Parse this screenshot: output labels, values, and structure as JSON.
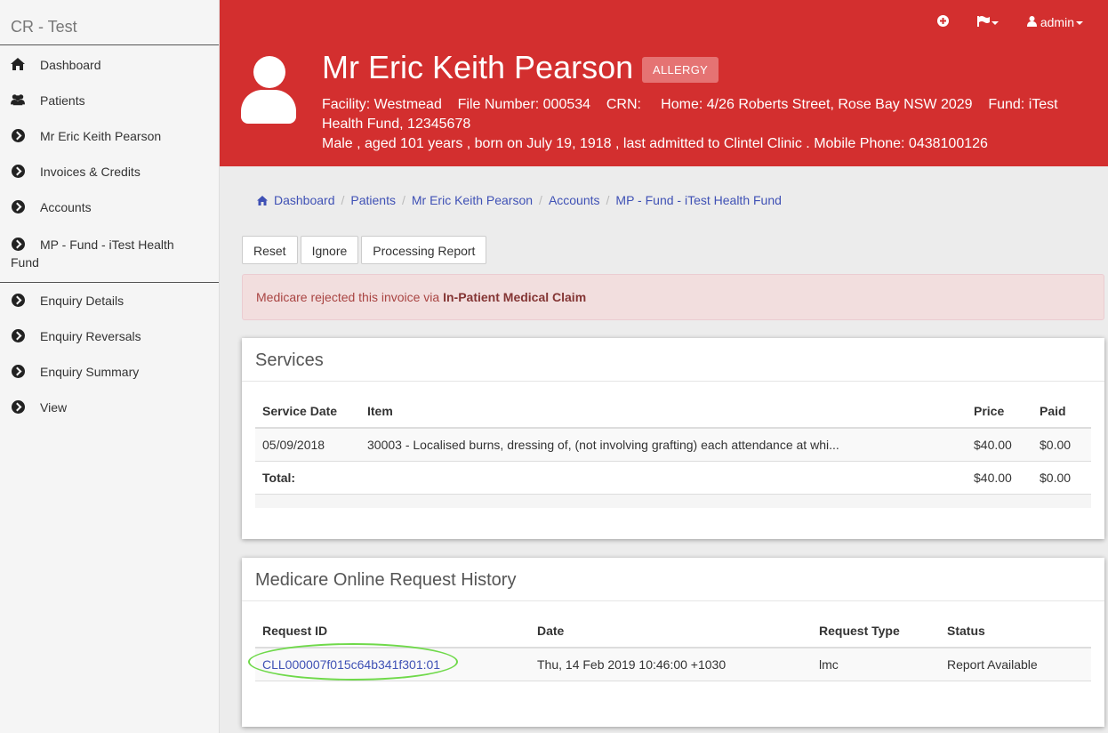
{
  "app": {
    "title": "CR - Test"
  },
  "sidebar": {
    "items": [
      {
        "label": "Dashboard",
        "icon": "home-icon"
      },
      {
        "label": "Patients",
        "icon": "users-icon"
      },
      {
        "label": "Mr Eric Keith Pearson",
        "icon": "chevron-circle-right-icon"
      },
      {
        "label": "Invoices & Credits",
        "icon": "chevron-circle-right-icon"
      },
      {
        "label": "Accounts",
        "icon": "chevron-circle-right-icon"
      },
      {
        "label": "MP - Fund - iTest Health Fund",
        "icon": "chevron-circle-right-icon"
      },
      {
        "label": "Enquiry Details",
        "icon": "chevron-circle-right-icon"
      },
      {
        "label": "Enquiry Reversals",
        "icon": "chevron-circle-right-icon"
      },
      {
        "label": "Enquiry Summary",
        "icon": "chevron-circle-right-icon"
      },
      {
        "label": "View",
        "icon": "chevron-circle-right-icon"
      }
    ]
  },
  "topnav": {
    "user": "admin"
  },
  "patient": {
    "name": "Mr Eric Keith Pearson",
    "badge": "ALLERGY",
    "line1": "Facility: Westmead    File Number: 000534    CRN:     Home: 4/26 Roberts Street, Rose Bay NSW 2029    Fund: iTest Health Fund, 12345678",
    "line2": "Male , aged 101 years , born on July 19, 1918 , last admitted to Clintel Clinic . Mobile Phone: 0438100126"
  },
  "breadcrumb": [
    "Dashboard",
    "Patients",
    "Mr Eric Keith Pearson",
    "Accounts",
    "MP - Fund - iTest Health Fund"
  ],
  "actions": {
    "reset": "Reset",
    "ignore": "Ignore",
    "report": "Processing Report"
  },
  "alert": {
    "text": "Medicare rejected this invoice via ",
    "bold": "In-Patient Medical Claim"
  },
  "services": {
    "title": "Services",
    "headers": {
      "date": "Service Date",
      "item": "Item",
      "price": "Price",
      "paid": "Paid"
    },
    "row": {
      "date": "05/09/2018",
      "item": "30003 - Localised burns, dressing of, (not involving grafting) each attendance at whi...",
      "price": "$40.00",
      "paid": "$0.00"
    },
    "total": {
      "label": "Total:",
      "price": "$40.00",
      "paid": "$0.00"
    }
  },
  "history": {
    "title": "Medicare Online Request History",
    "headers": {
      "id": "Request ID",
      "date": "Date",
      "type": "Request Type",
      "status": "Status"
    },
    "row": {
      "id": "CLL000007f015c64b341f301:01",
      "date": "Thu, 14 Feb 2019 10:46:00 +1030",
      "type": "lmc",
      "status": "Report Available"
    }
  },
  "colors": {
    "header": "#d32f2f",
    "link": "#3f51b5",
    "highlight": "#6fd94a"
  }
}
